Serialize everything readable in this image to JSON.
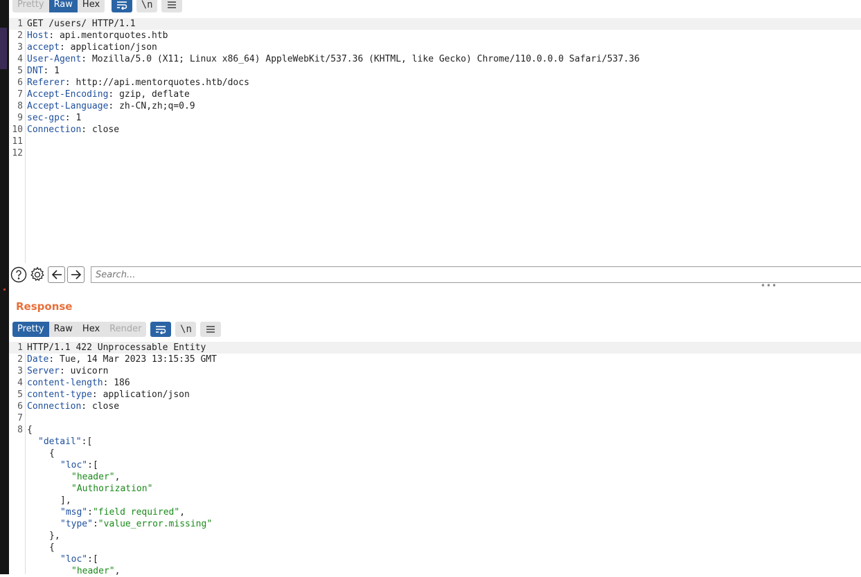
{
  "request": {
    "tabs": [
      {
        "label": "Pretty",
        "state": "disabled"
      },
      {
        "label": "Raw",
        "state": "active"
      },
      {
        "label": "Hex",
        "state": "normal"
      }
    ],
    "newline_toggle": "\\n",
    "lines": [
      {
        "n": "1",
        "key": "",
        "sep": "",
        "val": "GET /users/ HTTP/1.1"
      },
      {
        "n": "2",
        "key": "Host",
        "sep": ": ",
        "val": "api.mentorquotes.htb"
      },
      {
        "n": "3",
        "key": "accept",
        "sep": ": ",
        "val": "application/json"
      },
      {
        "n": "4",
        "key": "User-Agent",
        "sep": ": ",
        "val": "Mozilla/5.0 (X11; Linux x86_64) AppleWebKit/537.36 (KHTML, like Gecko) Chrome/110.0.0.0 Safari/537.36"
      },
      {
        "n": "5",
        "key": "DNT",
        "sep": ": ",
        "val": "1"
      },
      {
        "n": "6",
        "key": "Referer",
        "sep": ": ",
        "val": "http://api.mentorquotes.htb/docs"
      },
      {
        "n": "7",
        "key": "Accept-Encoding",
        "sep": ": ",
        "val": "gzip, deflate"
      },
      {
        "n": "8",
        "key": "Accept-Language",
        "sep": ": ",
        "val": "zh-CN,zh;q=0.9"
      },
      {
        "n": "9",
        "key": "sec-gpc",
        "sep": ": ",
        "val": "1"
      },
      {
        "n": "10",
        "key": "Connection",
        "sep": ": ",
        "val": "close"
      },
      {
        "n": "11",
        "key": "",
        "sep": "",
        "val": ""
      },
      {
        "n": "12",
        "key": "",
        "sep": "",
        "val": ""
      }
    ]
  },
  "search": {
    "placeholder": "Search..."
  },
  "response": {
    "title": "Response",
    "tabs": [
      {
        "label": "Pretty",
        "state": "active"
      },
      {
        "label": "Raw",
        "state": "normal"
      },
      {
        "label": "Hex",
        "state": "normal"
      },
      {
        "label": "Render",
        "state": "disabled"
      }
    ],
    "newline_toggle": "\\n",
    "lines": [
      {
        "n": "1",
        "key": "",
        "sep": "",
        "val": "HTTP/1.1 422 Unprocessable Entity"
      },
      {
        "n": "2",
        "key": "Date",
        "sep": ": ",
        "val": "Tue, 14 Mar 2023 13:15:35 GMT"
      },
      {
        "n": "3",
        "key": "Server",
        "sep": ": ",
        "val": "uvicorn"
      },
      {
        "n": "4",
        "key": "content-length",
        "sep": ": ",
        "val": "186"
      },
      {
        "n": "5",
        "key": "content-type",
        "sep": ": ",
        "val": "application/json"
      },
      {
        "n": "6",
        "key": "Connection",
        "sep": ": ",
        "val": "close"
      },
      {
        "n": "7",
        "key": "",
        "sep": "",
        "val": ""
      }
    ],
    "json_lines": [
      {
        "n": "8",
        "indent": 0,
        "jkey": "",
        "rest": "{",
        "jval": "",
        "tail": ""
      },
      {
        "n": "",
        "indent": 1,
        "jkey": "\"detail\"",
        "rest": ":[",
        "jval": "",
        "tail": ""
      },
      {
        "n": "",
        "indent": 2,
        "jkey": "",
        "rest": "{",
        "jval": "",
        "tail": ""
      },
      {
        "n": "",
        "indent": 3,
        "jkey": "\"loc\"",
        "rest": ":[",
        "jval": "",
        "tail": ""
      },
      {
        "n": "",
        "indent": 4,
        "jkey": "",
        "rest": "",
        "jval": "\"header\"",
        "tail": ","
      },
      {
        "n": "",
        "indent": 4,
        "jkey": "",
        "rest": "",
        "jval": "\"Authorization\"",
        "tail": ""
      },
      {
        "n": "",
        "indent": 3,
        "jkey": "",
        "rest": "],",
        "jval": "",
        "tail": ""
      },
      {
        "n": "",
        "indent": 3,
        "jkey": "\"msg\"",
        "rest": ":",
        "jval": "\"field required\"",
        "tail": ","
      },
      {
        "n": "",
        "indent": 3,
        "jkey": "\"type\"",
        "rest": ":",
        "jval": "\"value_error.missing\"",
        "tail": ""
      },
      {
        "n": "",
        "indent": 2,
        "jkey": "",
        "rest": "},",
        "jval": "",
        "tail": ""
      },
      {
        "n": "",
        "indent": 2,
        "jkey": "",
        "rest": "{",
        "jval": "",
        "tail": ""
      },
      {
        "n": "",
        "indent": 3,
        "jkey": "\"loc\"",
        "rest": ":[",
        "jval": "",
        "tail": ""
      },
      {
        "n": "",
        "indent": 4,
        "jkey": "",
        "rest": "",
        "jval": "\"header\"",
        "tail": ","
      }
    ]
  },
  "colors": {
    "accent": "#2b64a5",
    "response_title": "#e8703a",
    "header_key": "#1e4f9c",
    "json_string": "#1a8a1a"
  },
  "icons": [
    "wrap-lines-icon",
    "menu-icon",
    "help-icon",
    "gear-icon",
    "arrow-left-icon",
    "arrow-right-icon"
  ]
}
